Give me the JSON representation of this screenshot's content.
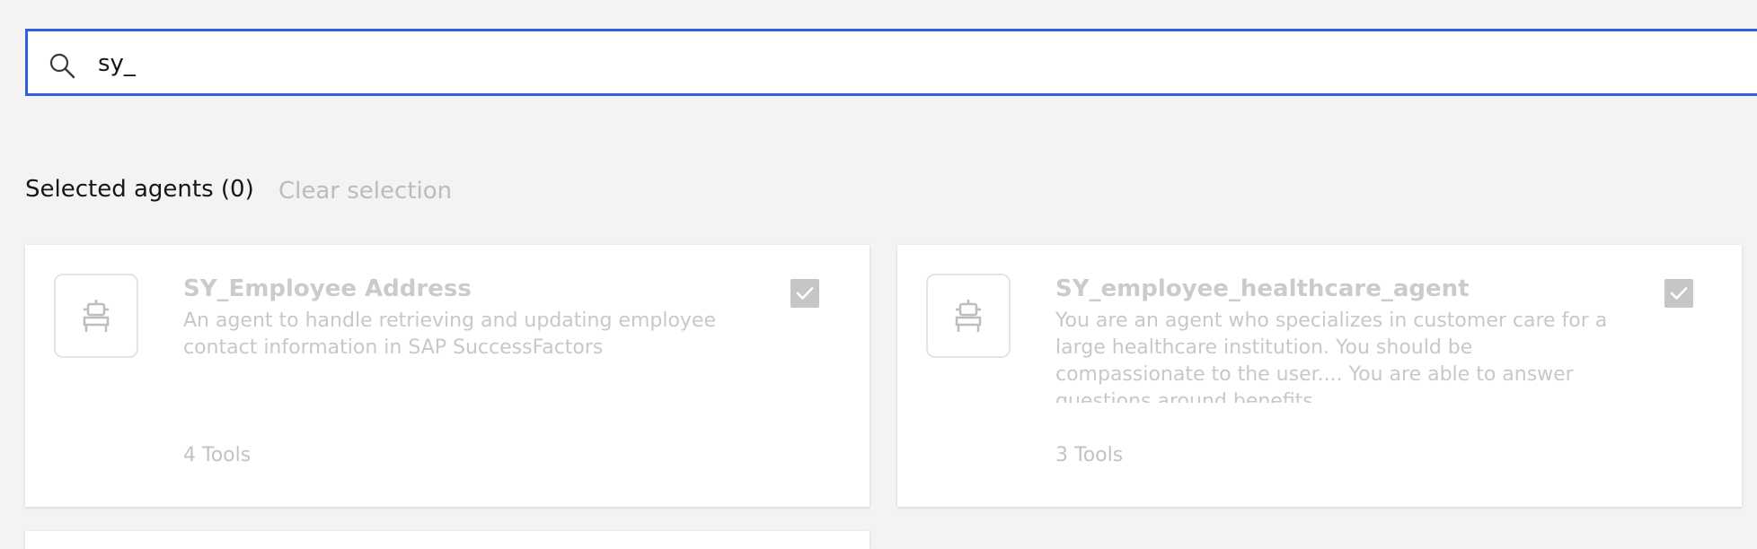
{
  "search": {
    "value": "sy_",
    "icon": "search-icon"
  },
  "selection": {
    "label": "Selected agents (0)",
    "clear_label": "Clear selection"
  },
  "agents": [
    {
      "name": "SY_Employee Address",
      "description": "An agent to handle retrieving and updating employee contact information in SAP SuccessFactors",
      "tools": "4 Tools",
      "icon": "robot-icon",
      "checked": true
    },
    {
      "name": "SY_employee_healthcare_agent",
      "description": "You are an agent who specializes in customer care for a large healthcare institution. You should be compassionate to the user.... You are able to answer questions around benefits",
      "tools": "3 Tools",
      "icon": "robot-icon",
      "checked": true
    }
  ],
  "colors": {
    "accent": "#2f5fe0",
    "background": "#f3f3f3",
    "disabled_text": "#c8c8c8",
    "checkbox_disabled": "#c6c6c6"
  }
}
